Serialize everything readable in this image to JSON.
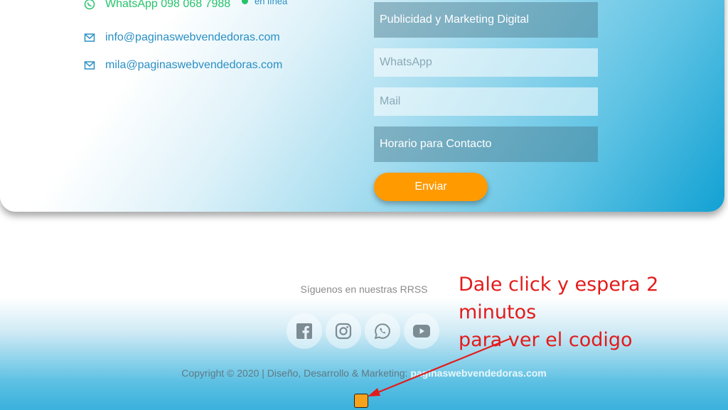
{
  "contact": {
    "whatsapp": "WhatsApp 098 068 7988",
    "status": "en línea",
    "email1": "info@paginaswebvendedoras.com",
    "email2": "mila@paginaswebvendedoras.com"
  },
  "form": {
    "service_value": "Publicidad y Marketing Digital",
    "whatsapp_placeholder": "WhatsApp",
    "mail_placeholder": "Mail",
    "schedule_value": "Horario para Contacto",
    "send_label": "Enviar"
  },
  "footer": {
    "follow_label": "Síguenos en nuestras RRSS",
    "socials": [
      "facebook-icon",
      "instagram-icon",
      "whatsapp-icon",
      "youtube-icon"
    ],
    "copyright_text": "Copyright © 2020 | Diseño, Desarrollo & Marketing:",
    "copyright_brand": "paginaswebvendedoras.com"
  },
  "annotation": {
    "line1": "Dale click y espera 2 minutos",
    "line2": "para ver el codigo"
  },
  "colors": {
    "accent_orange": "#ff9a00",
    "annotation_red": "#e31b1b",
    "whatsapp_green": "#25c36a"
  }
}
